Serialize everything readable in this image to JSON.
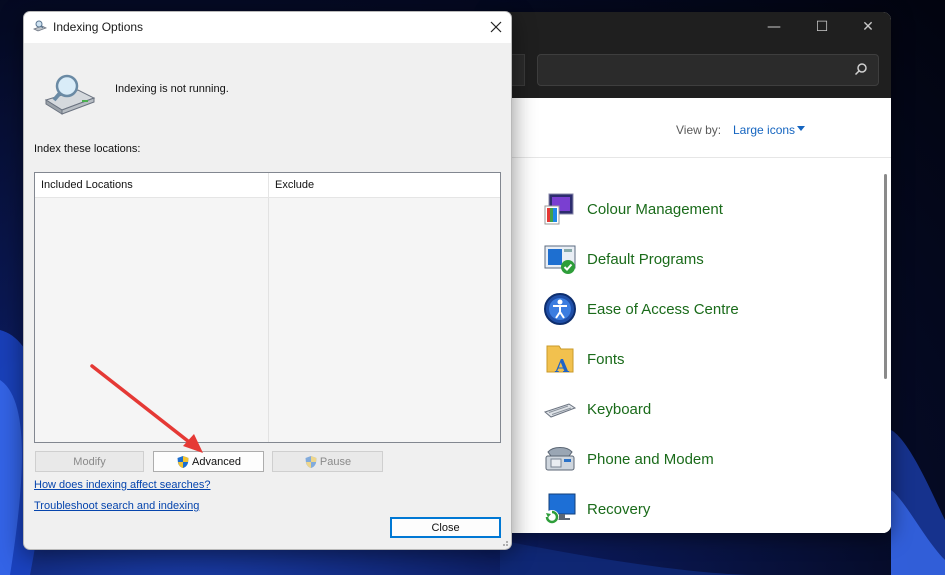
{
  "control_panel": {
    "view_by_label": "View by:",
    "view_by_value": "Large icons",
    "items": [
      {
        "label": "Colour Management",
        "icon": "colour-management-icon"
      },
      {
        "label": "Default Programs",
        "icon": "default-programs-icon"
      },
      {
        "label": "Ease of Access Centre",
        "icon": "ease-of-access-icon"
      },
      {
        "label": "Fonts",
        "icon": "fonts-icon"
      },
      {
        "label": "Keyboard",
        "icon": "keyboard-icon"
      },
      {
        "label": "Phone and Modem",
        "icon": "phone-modem-icon"
      },
      {
        "label": "Recovery",
        "icon": "recovery-icon"
      }
    ],
    "caption_buttons": {
      "minimize": "—",
      "maximize": "☐",
      "close": "✕"
    }
  },
  "dialog": {
    "title": "Indexing Options",
    "close_glyph": "✕",
    "status": "Indexing is not running.",
    "list_label": "Index these locations:",
    "columns": [
      "Included Locations",
      "Exclude"
    ],
    "buttons": {
      "modify": "Modify",
      "advanced": "Advanced",
      "pause": "Pause",
      "close": "Close"
    },
    "links": {
      "how_indexing": "How does indexing affect searches?",
      "troubleshoot": "Troubleshoot search and indexing"
    }
  },
  "colors": {
    "link": "#0645ad",
    "cp_link": "#1a6b1a",
    "accent": "#0078d4",
    "annotation_arrow": "#e53935"
  }
}
